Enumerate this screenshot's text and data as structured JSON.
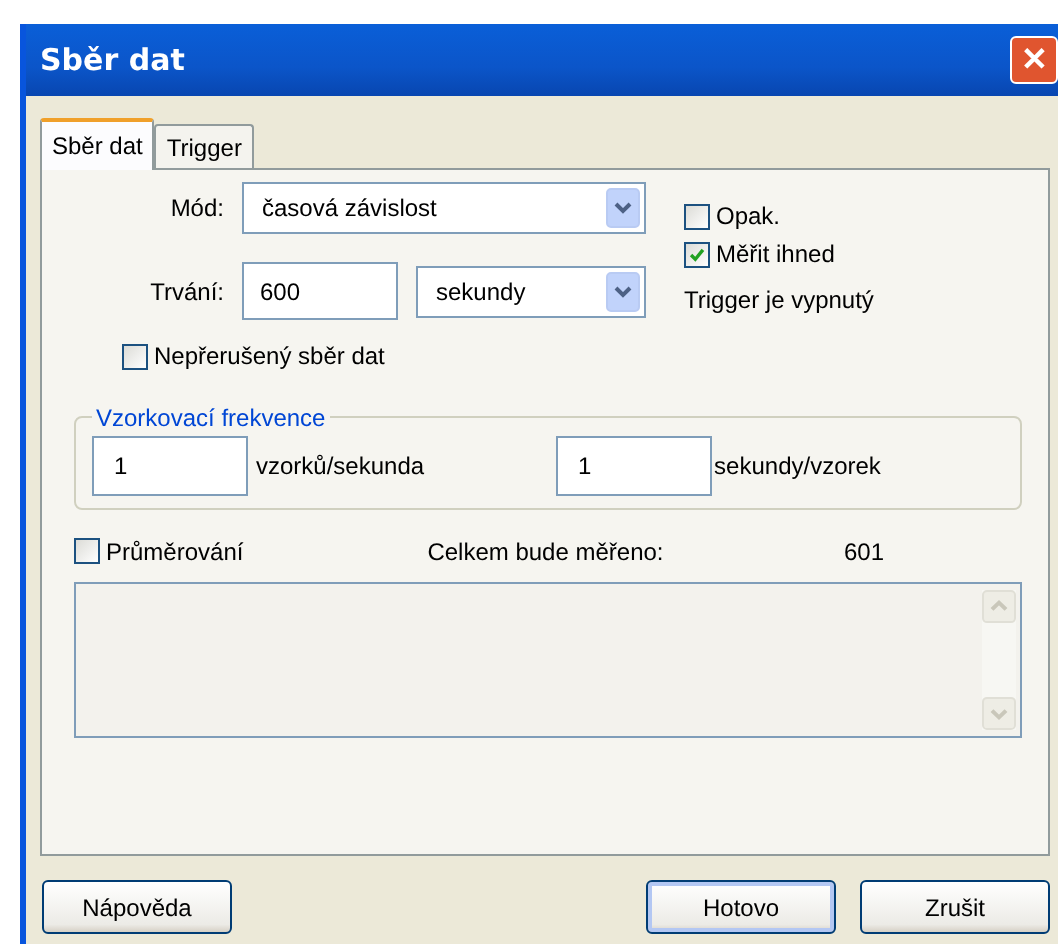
{
  "window": {
    "title": "Sběr dat",
    "close": "✕"
  },
  "tabs": [
    {
      "label": "Sběr dat",
      "selected": true
    },
    {
      "label": "Trigger",
      "selected": false
    }
  ],
  "mode": {
    "label": "Mód:",
    "value": "časová závislost"
  },
  "duration": {
    "label": "Trvání:",
    "value": "600",
    "unit": "sekundy"
  },
  "options": [
    {
      "label": "Opak.",
      "checked": false
    },
    {
      "label": "Měřit ihned",
      "checked": true
    }
  ],
  "trigger_status": "Trigger je vypnutý",
  "continuous": {
    "label": "Nepřerušený sběr dat",
    "checked": false
  },
  "sampling": {
    "legend": "Vzorkovací frekvence",
    "rate_value": "1",
    "rate_unit": "vzorků/sekunda",
    "period_value": "1",
    "period_unit": "sekundy/vzorek"
  },
  "averaging": {
    "label": "Průměrování",
    "checked": false
  },
  "total": {
    "label": "Celkem bude měřeno:",
    "value": "601"
  },
  "buttons": [
    {
      "label": "Nápověda",
      "default": false
    },
    {
      "label": "Hotovo",
      "default": true
    },
    {
      "label": "Zrušit",
      "default": false
    }
  ]
}
